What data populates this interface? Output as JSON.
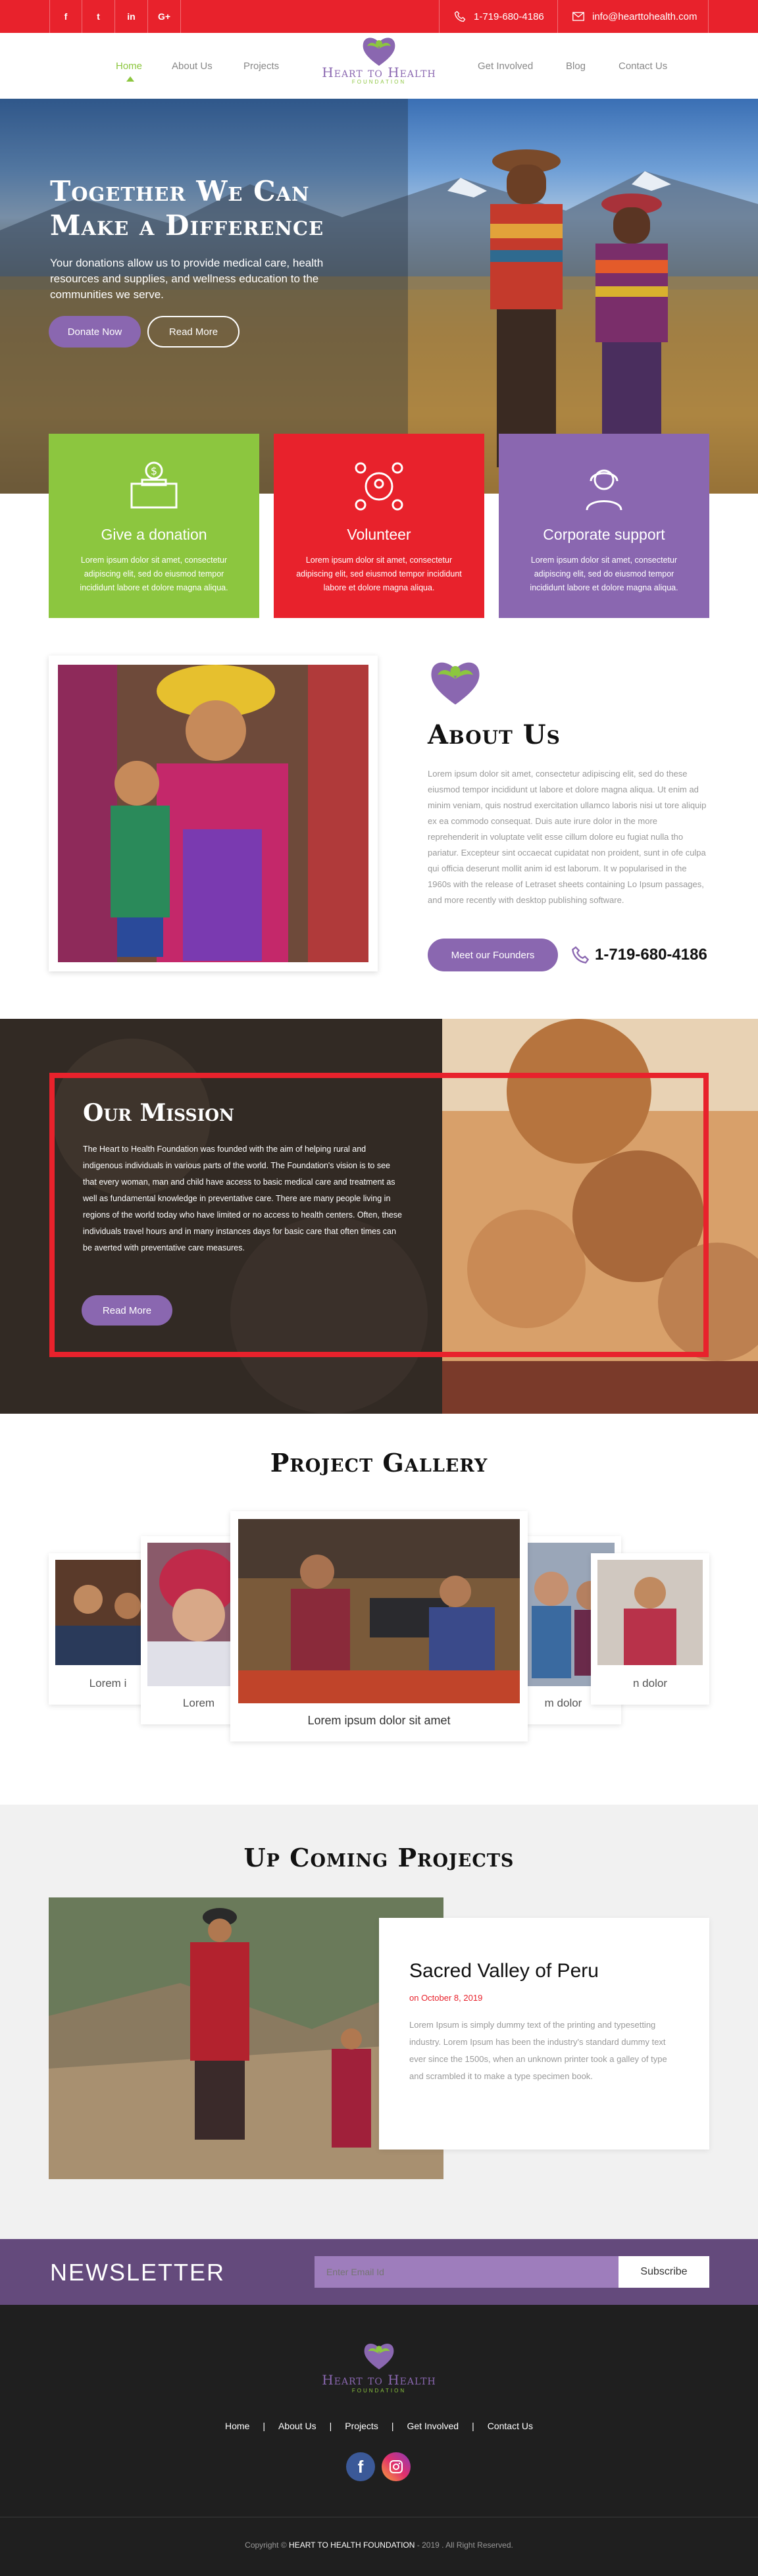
{
  "topbar": {
    "social": [
      {
        "name": "facebook-icon",
        "glyph": "f"
      },
      {
        "name": "twitter-icon",
        "glyph": "t"
      },
      {
        "name": "linkedin-icon",
        "glyph": "in"
      },
      {
        "name": "google-plus-icon",
        "glyph": "G+"
      }
    ],
    "phone": "1-719-680-4186",
    "email": "info@hearttohealth.com",
    "color": "#e8222c"
  },
  "logo": {
    "line1": "Heart to Health",
    "line2": "FOUNDATION"
  },
  "nav": {
    "items": [
      "Home",
      "About Us",
      "Projects",
      "Get Involved",
      "Blog",
      "Contact Us"
    ],
    "active": "Home"
  },
  "hero": {
    "title_line1": "Together We Can",
    "title_line2": "Make a Difference",
    "text": "Your donations allow us to provide medical care, health resources and supplies, and wellness education to the communities we serve.",
    "donate_label": "Donate Now",
    "read_more_label": "Read More"
  },
  "cards": [
    {
      "title": "Give a donation",
      "text": "Lorem ipsum dolor sit amet, consectetur adipiscing elit, sed do eiusmod tempor incididunt labore et dolore magna aliqua.",
      "color": "#8cc63f",
      "icon": "donation-box-icon"
    },
    {
      "title": "Volunteer",
      "text": "Lorem ipsum dolor sit amet, consectetur adipiscing elit, sed eiusmod tempor incididunt labore et dolore magna aliqua.",
      "color": "#e8222c",
      "icon": "volunteer-network-icon"
    },
    {
      "title": "Corporate support",
      "text": "Lorem ipsum dolor sit amet, consectetur adipiscing elit, sed do eiusmod tempor incididunt labore et dolore magna aliqua.",
      "color": "#8a67b0",
      "icon": "headset-support-icon"
    }
  ],
  "about": {
    "title": "About Us",
    "text": "Lorem ipsum dolor sit amet, consectetur adipiscing elit, sed do these eiusmod tempor incididunt ut labore et dolore magna aliqua. Ut enim ad minim veniam, quis nostrud exercitation ullamco laboris nisi ut tore aliquip ex ea commodo consequat. Duis aute irure dolor in the more reprehenderit in voluptate velit esse cillum dolore eu fugiat nulla tho pariatur. Excepteur sint occaecat cupidatat non proident, sunt in ofe culpa qui officia deserunt mollit anim id est laborum. It w popularised in the 1960s with the release of Letraset sheets containing Lo Ipsum passages, and more recently with desktop publishing software.",
    "button_label": "Meet our Founders",
    "phone": "1-719-680-4186"
  },
  "mission": {
    "title": "Our Mission",
    "text": "The Heart to Health Foundation was founded with the aim of helping rural and indigenous individuals in various parts of the world. The Foundation's vision is to see that every woman, man and child have access to basic medical care and treatment as well as fundamental knowledge in preventative care. There are many people living in regions of the world today who have limited or no access to health centers. Often, these individuals travel hours and in many instances days for basic care that often times can be averted with preventative care measures.",
    "button_label": "Read More"
  },
  "gallery": {
    "title": "Project Gallery",
    "items": [
      {
        "caption": "Lorem i"
      },
      {
        "caption": "Lorem"
      },
      {
        "caption": "Lorem ipsum dolor sit amet"
      },
      {
        "caption": "m dolor"
      },
      {
        "caption": "n dolor"
      }
    ]
  },
  "upcoming": {
    "title": "Up Coming Projects",
    "project_title": "Sacred Valley of Peru",
    "date": "on October 8, 2019",
    "text": "Lorem Ipsum is simply dummy text of the printing and typesetting industry. Lorem Ipsum has been the industry's standard dummy text ever since the 1500s, when an unknown printer took a galley of type and scrambled it to make a type specimen book."
  },
  "newsletter": {
    "title": "NEWSLETTER",
    "placeholder": "Enter Email Id",
    "subscribe_label": "Subscribe"
  },
  "footer": {
    "links": [
      "Home",
      "About Us",
      "Projects",
      "Get Involved",
      "Contact Us"
    ],
    "copyright_prefix": "Copyright ©",
    "copyright_brand": "HEART TO HEALTH FOUNDATION",
    "copyright_suffix": "- 2019 . All Right Reserved."
  }
}
